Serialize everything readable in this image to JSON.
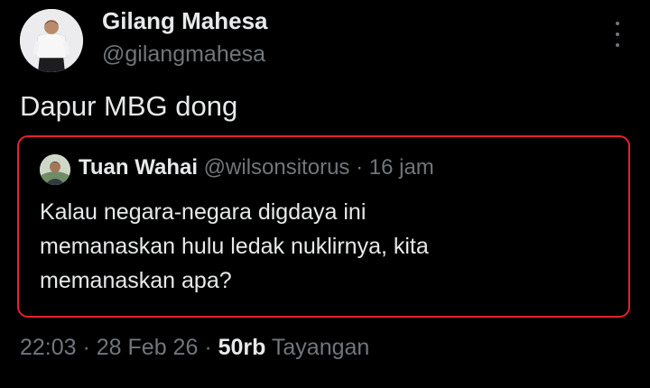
{
  "author": {
    "name": "Gilang Mahesa",
    "handle": "@gilangmahesa"
  },
  "tweet": {
    "text": "Dapur MBG dong"
  },
  "menu": {
    "icon": "more-vertical-icon"
  },
  "quoted_tweet": {
    "name": "Tuan Wahai",
    "handle": "@wilsonsitorus",
    "separator": " · ",
    "time": "16 jam",
    "lines": [
      "Kalau negara-negara digdaya ini",
      "memanaskan hulu ledak nuklirnya, kita",
      "memanaskan apa?"
    ]
  },
  "meta": {
    "time": "22:03",
    "separator": " · ",
    "date": "28 Feb 26",
    "views_count": "50rb",
    "views_label": "Tayangan"
  },
  "colors": {
    "background": "#000000",
    "text_primary": "#e7e9ea",
    "text_secondary": "#71767b",
    "highlight_border": "#e8212c"
  }
}
